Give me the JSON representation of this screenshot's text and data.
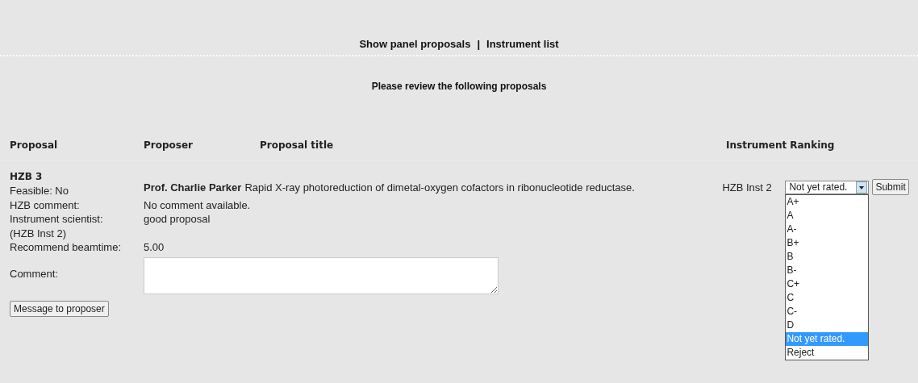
{
  "nav": {
    "links": [
      "Show panel proposals",
      "Instrument list"
    ],
    "separator": "|"
  },
  "heading": "Please review the following proposals",
  "table": {
    "columns": [
      "Proposal",
      "Proposer",
      "Proposal title",
      "Instrument",
      "Ranking"
    ],
    "rows": [
      {
        "proposal_id": "HZB 3",
        "proposer": "Prof. Charlie Parker",
        "title": "Rapid X-ray photoreduction of dimetal-oxygen cofactors in ribonucleotide reductase.",
        "instrument": "HZB Inst 2",
        "details": [
          {
            "label": "Feasible: No"
          },
          {
            "label": "HZB comment:",
            "value": "No comment available."
          },
          {
            "label": "Instrument scientist:",
            "value": "good proposal"
          },
          {
            "label": "(HZB Inst 2)"
          },
          {
            "label": "Recommend beamtime:",
            "value": "5.00"
          }
        ],
        "comment_label": "Comment:",
        "message_button": "Message to proposer",
        "ranking": {
          "value": "Not yet rated.",
          "expanded": true,
          "options": [
            {
              "label": "A+",
              "selected": false
            },
            {
              "label": "A",
              "selected": false
            },
            {
              "label": "A-",
              "selected": false
            },
            {
              "label": "B+",
              "selected": false
            },
            {
              "label": "B",
              "selected": false
            },
            {
              "label": "B-",
              "selected": false
            },
            {
              "label": "C+",
              "selected": false
            },
            {
              "label": "C",
              "selected": false
            },
            {
              "label": "C-",
              "selected": false
            },
            {
              "label": "D",
              "selected": false
            },
            {
              "label": "Not yet rated.",
              "selected": true
            },
            {
              "label": "Reject",
              "selected": false
            }
          ]
        },
        "submit_button": "Submit"
      }
    ]
  }
}
